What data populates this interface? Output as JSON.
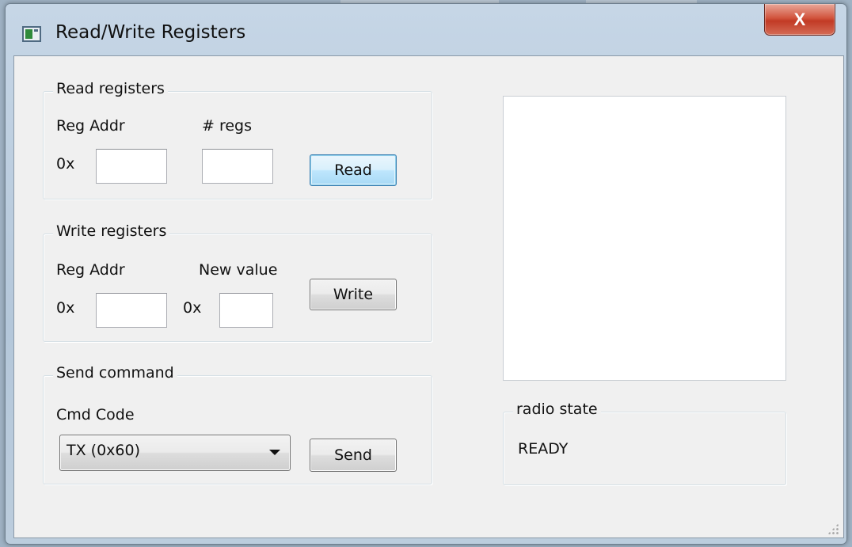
{
  "window": {
    "title": "Read/Write Registers",
    "close_label": "X"
  },
  "read_group": {
    "title": "Read registers",
    "reg_addr_label": "Reg Addr",
    "num_regs_label": "# regs",
    "prefix": "0x",
    "reg_addr_value": "",
    "num_regs_value": "",
    "button_label": "Read"
  },
  "write_group": {
    "title": "Write registers",
    "reg_addr_label": "Reg Addr",
    "new_value_label": "New value",
    "addr_prefix": "0x",
    "value_prefix": "0x",
    "reg_addr_value": "",
    "new_value_value": "",
    "button_label": "Write"
  },
  "command_group": {
    "title": "Send command",
    "cmd_code_label": "Cmd Code",
    "selected": "TX (0x60)",
    "button_label": "Send"
  },
  "radio_state": {
    "title": "radio state",
    "value": "READY"
  },
  "icons": {
    "app": "app-window-icon",
    "close": "close-icon",
    "dropdown": "chevron-down-icon",
    "grip": "resize-grip-icon"
  },
  "colors": {
    "close_button": "#c23a25",
    "default_button_border": "#3c7fb1",
    "client_background": "#f0f0f0"
  }
}
